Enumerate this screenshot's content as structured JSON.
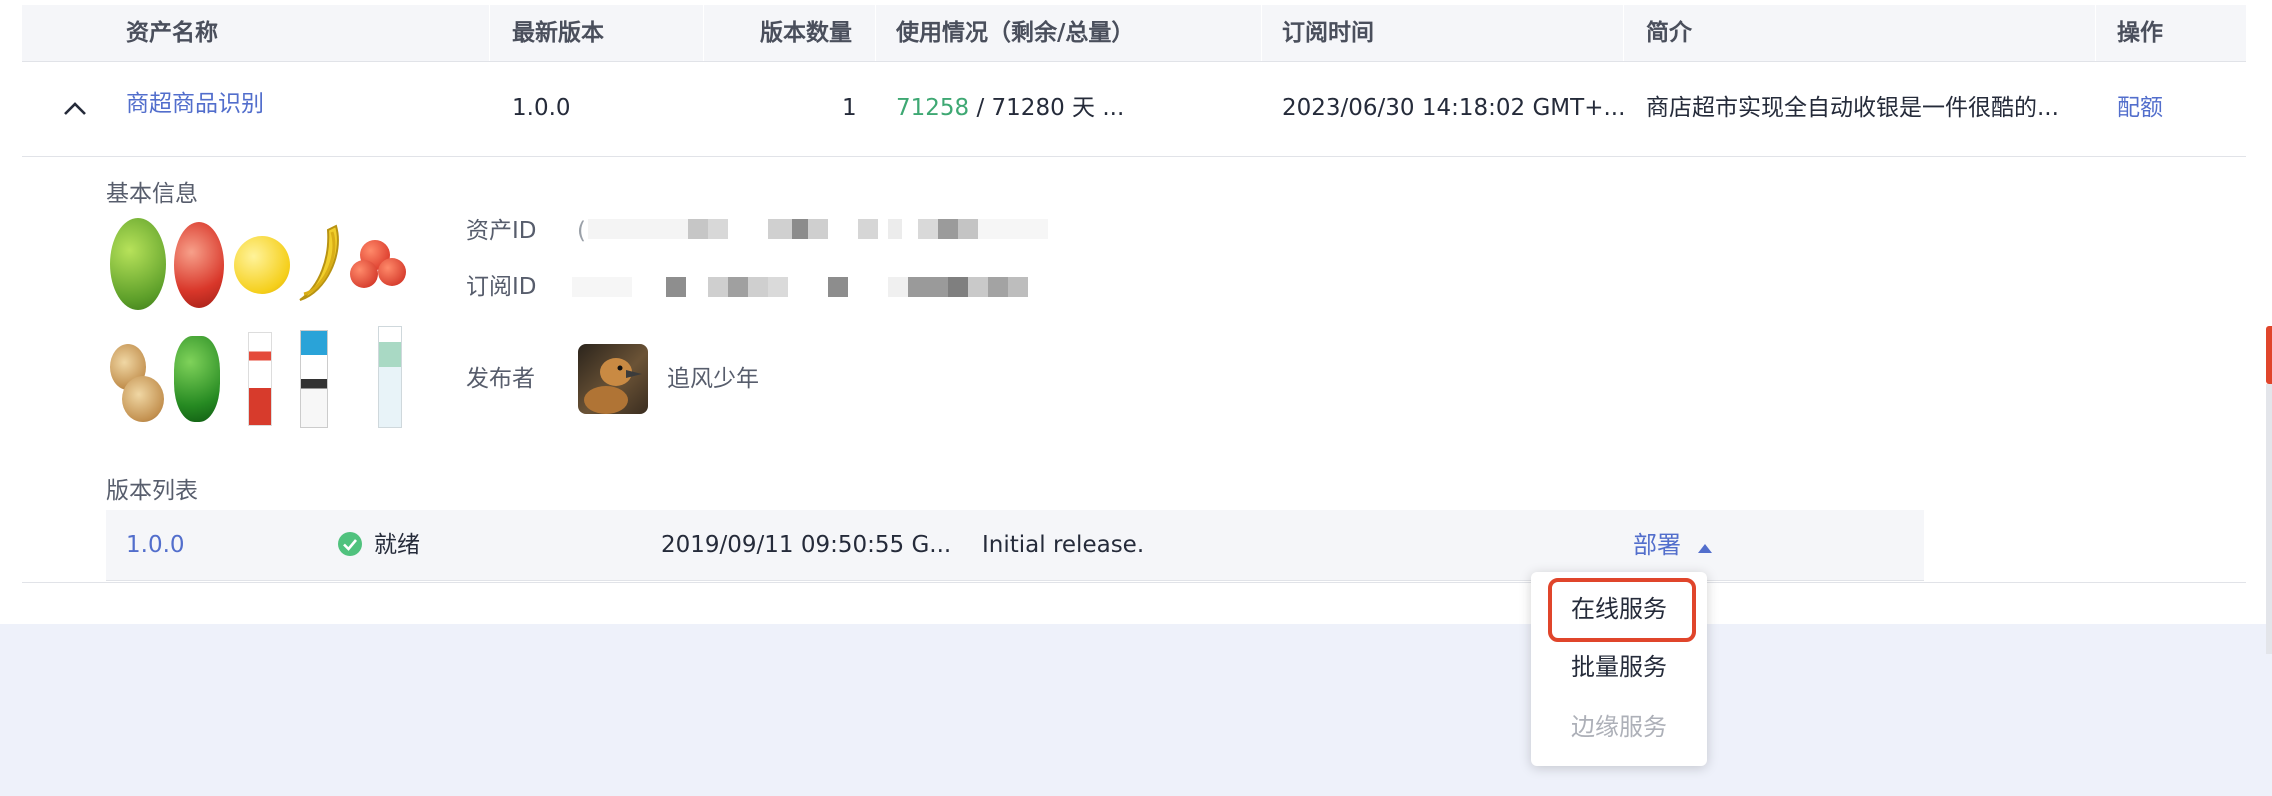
{
  "table": {
    "headers": {
      "name": "资产名称",
      "latest_version": "最新版本",
      "version_count": "版本数量",
      "usage": "使用情况（剩余/总量）",
      "subscribed_at": "订阅时间",
      "summary": "简介",
      "actions": "操作"
    },
    "row": {
      "name": "商超商品识别",
      "latest_version": "1.0.0",
      "version_count": "1",
      "usage_remaining": "71258",
      "usage_rest": "/ 71280 天 ...",
      "subscribed_at": "2023/06/30 14:18:02 GMT+...",
      "summary": "商店超市实现全自动收银是一件很酷的...",
      "action_quota": "配额"
    }
  },
  "detail": {
    "basic_info_title": "基本信息",
    "asset_id_label": "资产ID",
    "asset_id_prefix": "(",
    "subscription_id_label": "订阅ID",
    "publisher_label": "发布者",
    "publisher_name": "追风少年",
    "version_list_title": "版本列表"
  },
  "versions": [
    {
      "version": "1.0.0",
      "status": "就绪",
      "created": "2019/09/11 09:50:55 G...",
      "description": "Initial release.",
      "deploy_label": "部署"
    }
  ],
  "deploy_menu": {
    "items": [
      {
        "label": "在线服务",
        "disabled": false,
        "highlighted": true
      },
      {
        "label": "批量服务",
        "disabled": false,
        "highlighted": false
      },
      {
        "label": "边缘服务",
        "disabled": true,
        "highlighted": false
      }
    ]
  },
  "colors": {
    "link": "#526ecc",
    "remaining": "#3ea873",
    "highlight_border": "#e0452b",
    "status_ok": "#50c27e",
    "footer_bg": "#eef1fa"
  }
}
